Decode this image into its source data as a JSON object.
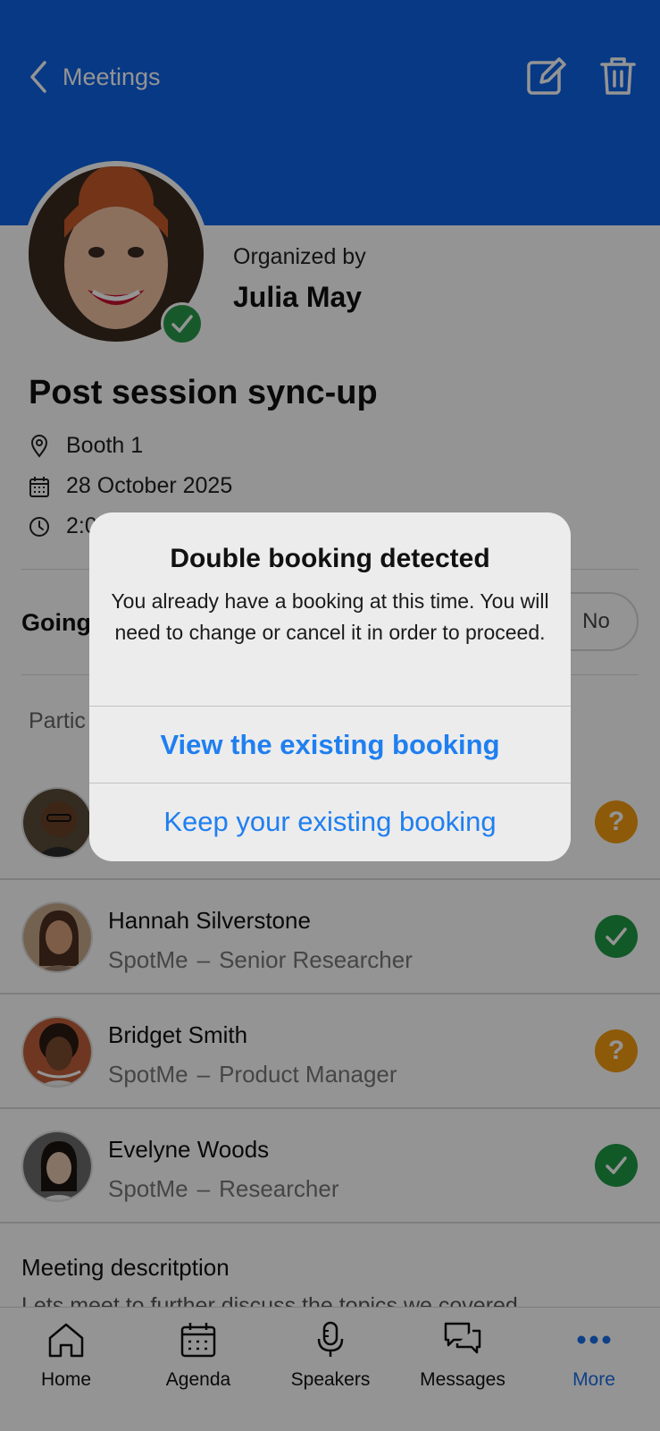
{
  "header": {
    "back_label": "Meetings",
    "edit_icon": "edit-icon",
    "delete_icon": "trash-icon"
  },
  "organizer": {
    "label": "Organized by",
    "name": "Julia May"
  },
  "meeting": {
    "title": "Post session sync-up",
    "location": "Booth 1",
    "date": "28 October 2025",
    "time_partial": "2:0"
  },
  "rsvp": {
    "label": "Going",
    "no_label": "No"
  },
  "participants": {
    "title": "Partic",
    "rows": [
      {
        "name": "",
        "company": "",
        "role": "",
        "status": "maybe"
      },
      {
        "name": "Hannah Silverstone",
        "company": "SpotMe",
        "role": "Senior Researcher",
        "status": "yes"
      },
      {
        "name": "Bridget Smith",
        "company": "SpotMe",
        "role": "Product Manager",
        "status": "maybe"
      },
      {
        "name": "Evelyne Woods",
        "company": "SpotMe",
        "role": "Researcher",
        "status": "yes"
      }
    ],
    "separator": "–",
    "maybe_glyph": "?"
  },
  "description": {
    "title": "Meeting descritption",
    "text": "Lets meet to further discuss the topics we covered"
  },
  "tabbar": {
    "items": [
      {
        "label": "Home",
        "icon": "home-icon"
      },
      {
        "label": "Agenda",
        "icon": "calendar-icon"
      },
      {
        "label": "Speakers",
        "icon": "microphone-icon"
      },
      {
        "label": "Messages",
        "icon": "messages-icon"
      },
      {
        "label": "More",
        "icon": "more-icon",
        "active": true
      }
    ]
  },
  "alert": {
    "title": "Double booking detected",
    "message": "You already have a booking at this time. You will need to change or cancel it in order to proceed.",
    "primary_action": "View the existing booking",
    "secondary_action": "Keep your existing booking"
  },
  "colors": {
    "header": "#0d63e6",
    "accent": "#1f7ff0",
    "status_yes": "#1f9a45",
    "status_maybe": "#f39b12"
  }
}
